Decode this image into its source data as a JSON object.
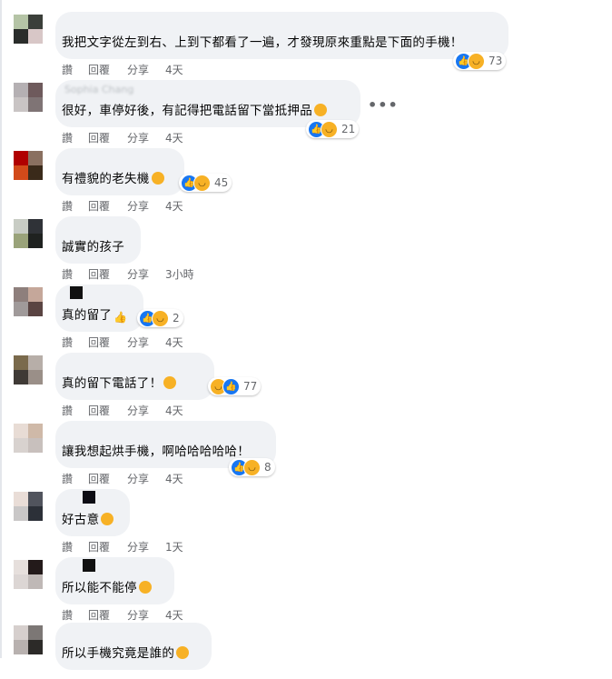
{
  "actions": {
    "like": "讚",
    "reply": "回覆",
    "share": "分享"
  },
  "more_menu": "•••",
  "comments": [
    {
      "name": "",
      "text": "我把文字從左到右、上到下都看了一遍，才發現原來重點是下面的手機！",
      "time": "4天",
      "reaction_count": "73",
      "emoji": ""
    },
    {
      "name": "Sophia Chang",
      "text": "很好，車停好後，有記得把電話留下當抵押品",
      "time": "4天",
      "reaction_count": "21",
      "emoji": "laughing"
    },
    {
      "name": "",
      "text": "有禮貌的老失機",
      "time": "4天",
      "reaction_count": "45",
      "emoji": "smirk"
    },
    {
      "name": "",
      "text": "誠實的孩子",
      "time": "3小時",
      "reaction_count": "",
      "emoji": ""
    },
    {
      "name": "",
      "text": "真的留了",
      "time": "4天",
      "reaction_count": "2",
      "emoji": "thumbs-up"
    },
    {
      "name": "",
      "text": "真的留下電話了！",
      "time": "4天",
      "reaction_count": "77",
      "emoji": "rolling-laughing"
    },
    {
      "name": "",
      "text": "讓我想起烘手機，啊哈哈哈哈哈！",
      "time": "4天",
      "reaction_count": "8",
      "emoji": ""
    },
    {
      "name": "",
      "text": "好古意",
      "time": "1天",
      "reaction_count": "",
      "emoji": "rolling-laughing"
    },
    {
      "name": "",
      "text": "所以能不能停",
      "time": "4天",
      "reaction_count": "",
      "emoji": "thinking"
    },
    {
      "name": "",
      "text": "所以手機究竟是誰的",
      "time": "",
      "reaction_count": "",
      "emoji": "grinning"
    }
  ],
  "colors": {
    "bubble": "#f0f2f5",
    "like_blue": "#1877f2",
    "haha_yellow": "#f7b125",
    "meta_gray": "#65676b"
  }
}
